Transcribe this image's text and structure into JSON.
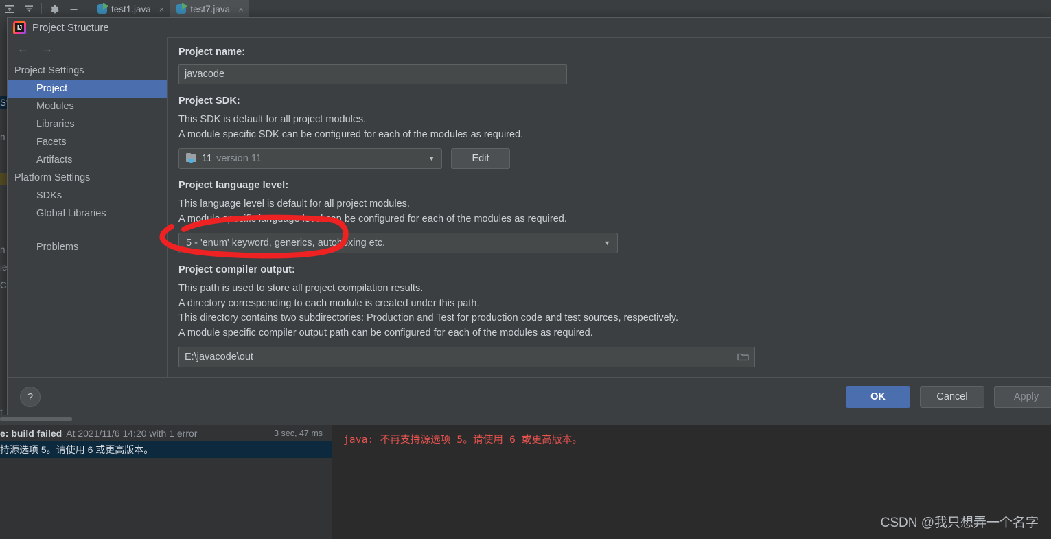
{
  "ide": {
    "toolbar_icons": [
      "expand-all-icon",
      "collapse-all-icon",
      "settings-gear-icon",
      "minimize-icon"
    ],
    "tabs": [
      {
        "label": "test1.java",
        "close": "×",
        "active": false
      },
      {
        "label": "test7.java",
        "close": "×",
        "active": true
      }
    ],
    "left_slivers": [
      "St",
      "n",
      "",
      "n",
      "ie",
      "C",
      "t"
    ]
  },
  "dialog": {
    "title": "Project Structure",
    "nav": {
      "back": "←",
      "forward": "→"
    },
    "sidebar": {
      "groups": [
        {
          "label": "Project Settings",
          "items": [
            {
              "label": "Project",
              "selected": true
            },
            {
              "label": "Modules",
              "selected": false
            },
            {
              "label": "Libraries",
              "selected": false
            },
            {
              "label": "Facets",
              "selected": false
            },
            {
              "label": "Artifacts",
              "selected": false
            }
          ]
        },
        {
          "label": "Platform Settings",
          "items": [
            {
              "label": "SDKs",
              "selected": false
            },
            {
              "label": "Global Libraries",
              "selected": false
            }
          ]
        }
      ],
      "extra": [
        {
          "label": "Problems",
          "selected": false
        }
      ]
    },
    "main": {
      "project_name_label": "Project name:",
      "project_name_value": "javacode",
      "sdk_label": "Project SDK:",
      "sdk_desc1": "This SDK is default for all project modules.",
      "sdk_desc2": "A module specific SDK can be configured for each of the modules as required.",
      "sdk_value": "11",
      "sdk_value_sub": "version 11",
      "sdk_caret": "▼",
      "edit_button": "Edit",
      "language_level_label": "Project language level:",
      "ll_desc1": "This language level is default for all project modules.",
      "ll_desc2": "A module specific language level can be configured for each of the modules as required.",
      "language_level_value": "5 - 'enum' keyword, generics, autoboxing etc.",
      "ll_caret": "▼",
      "compiler_output_label": "Project compiler output:",
      "co_desc1": "This path is used to store all project compilation results.",
      "co_desc2": "A directory corresponding to each module is created under this path.",
      "co_desc3": "This directory contains two subdirectories: Production and Test for production code and test sources, respectively.",
      "co_desc4": "A module specific compiler output path can be configured for each of the modules as required.",
      "compiler_output_value": "E:\\javacode\\out",
      "browse_icon": "Ὄ1"
    },
    "footer": {
      "help": "?",
      "ok": "OK",
      "cancel": "Cancel",
      "apply": "Apply"
    }
  },
  "annotation": {
    "color": "#ee2222",
    "shape": "hand-drawn-ellipse"
  },
  "build_panel": {
    "status_bold": "e: build failed",
    "status_dim": "At 2021/11/6 14:20 with 1 error",
    "duration": "3 sec, 47 ms",
    "selected_row": "持源选项 5。请使用 6 或更高版本。",
    "error_text": "java: 不再支持源选项 5。请使用 6 或更高版本。",
    "watermark": "CSDN @我只想弄一个名字"
  }
}
